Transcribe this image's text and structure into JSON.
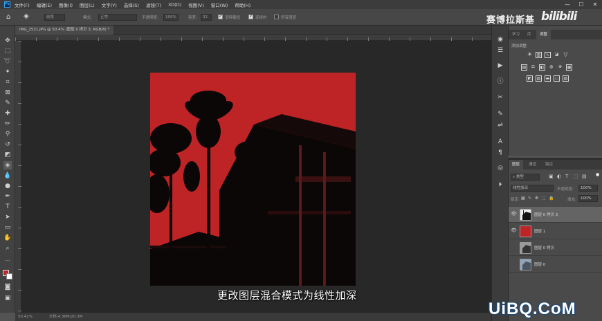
{
  "app": {
    "logo": "Ps",
    "menu": [
      "文件(F)",
      "编辑(E)",
      "图像(I)",
      "图层(L)",
      "文字(Y)",
      "选择(S)",
      "滤镜(T)",
      "3D(D)",
      "视图(V)",
      "窗口(W)",
      "帮助(H)"
    ],
    "window_controls": [
      "—",
      "☐",
      "✕"
    ]
  },
  "options_bar": {
    "tool_preset": "前景",
    "mode_label": "模式:",
    "mode_value": "正常",
    "opacity_label": "不透明度:",
    "opacity_value": "100%",
    "tolerance_label": "容差:",
    "tolerance_value": "32",
    "anti_alias_label": "消除锯齿",
    "contiguous_label": "连续的",
    "all_layers_label": "所有图层"
  },
  "watermark": {
    "author": "赛博拉斯基",
    "site": "bilibili"
  },
  "document": {
    "tab_title": "IMG_2521.JPG @ 50.4% (图层 0 拷贝 3, RGB/8) *",
    "zoom": "50.42%",
    "doc_info": "文档:4.36M/20.3M"
  },
  "subtitle": "更改图层混合模式为线性加深",
  "adjustments_panel": {
    "tabs": [
      "学习",
      "库",
      "调整"
    ],
    "title": "添加调整"
  },
  "layers_panel": {
    "tabs": [
      "图层",
      "通道",
      "路径"
    ],
    "filter_label": "类型",
    "blend_mode": "线性加深",
    "opacity_label": "不透明度:",
    "opacity_value": "100%",
    "lock_label": "锁定:",
    "fill_label": "填充:",
    "fill_value": "100%",
    "layers": [
      {
        "name": "图层 0 拷贝 3",
        "visible": true,
        "selected": true
      },
      {
        "name": "图层 1",
        "visible": true,
        "selected": false
      },
      {
        "name": "图层 0 拷贝",
        "visible": false,
        "selected": false
      },
      {
        "name": "图层 0",
        "visible": false,
        "selected": false
      }
    ]
  },
  "corner_watermark": "UiBQ.CoM",
  "colors": {
    "foreground": "#be2326",
    "background": "#ffffff",
    "canvas_red": "#be2326"
  }
}
